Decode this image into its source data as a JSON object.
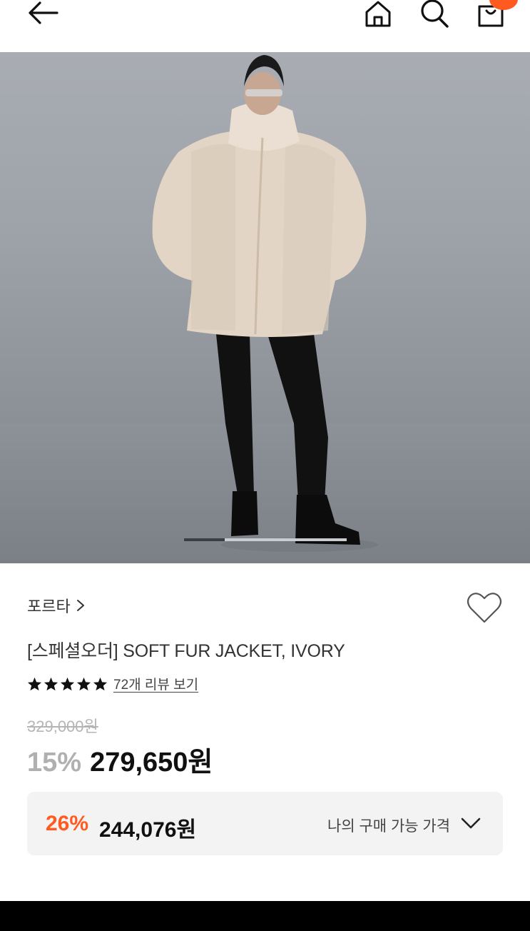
{
  "header": {
    "back_icon": "arrow-left-icon",
    "home_icon": "home-icon",
    "search_icon": "search-icon",
    "bag_icon": "shopping-bag-icon",
    "cart_badge": ""
  },
  "gallery": {
    "slide_progress": 0.25,
    "image_desc_icon": "product-photo"
  },
  "product": {
    "brand": "포르타",
    "title": "[스페셜오더] SOFT FUR JACKET, IVORY",
    "rating_stars": 5,
    "review_link": "72개 리뷰 보기",
    "original_price": "329,000원",
    "discount_rate": "15%",
    "sale_price": "279,650원"
  },
  "my_price": {
    "discount_rate": "26%",
    "price": "244,076원",
    "label": "나의 구매 가능 가격"
  },
  "colors": {
    "accent": "#ff5a1f",
    "muted": "#b0b0b0",
    "box_bg": "#f3f3f3"
  }
}
